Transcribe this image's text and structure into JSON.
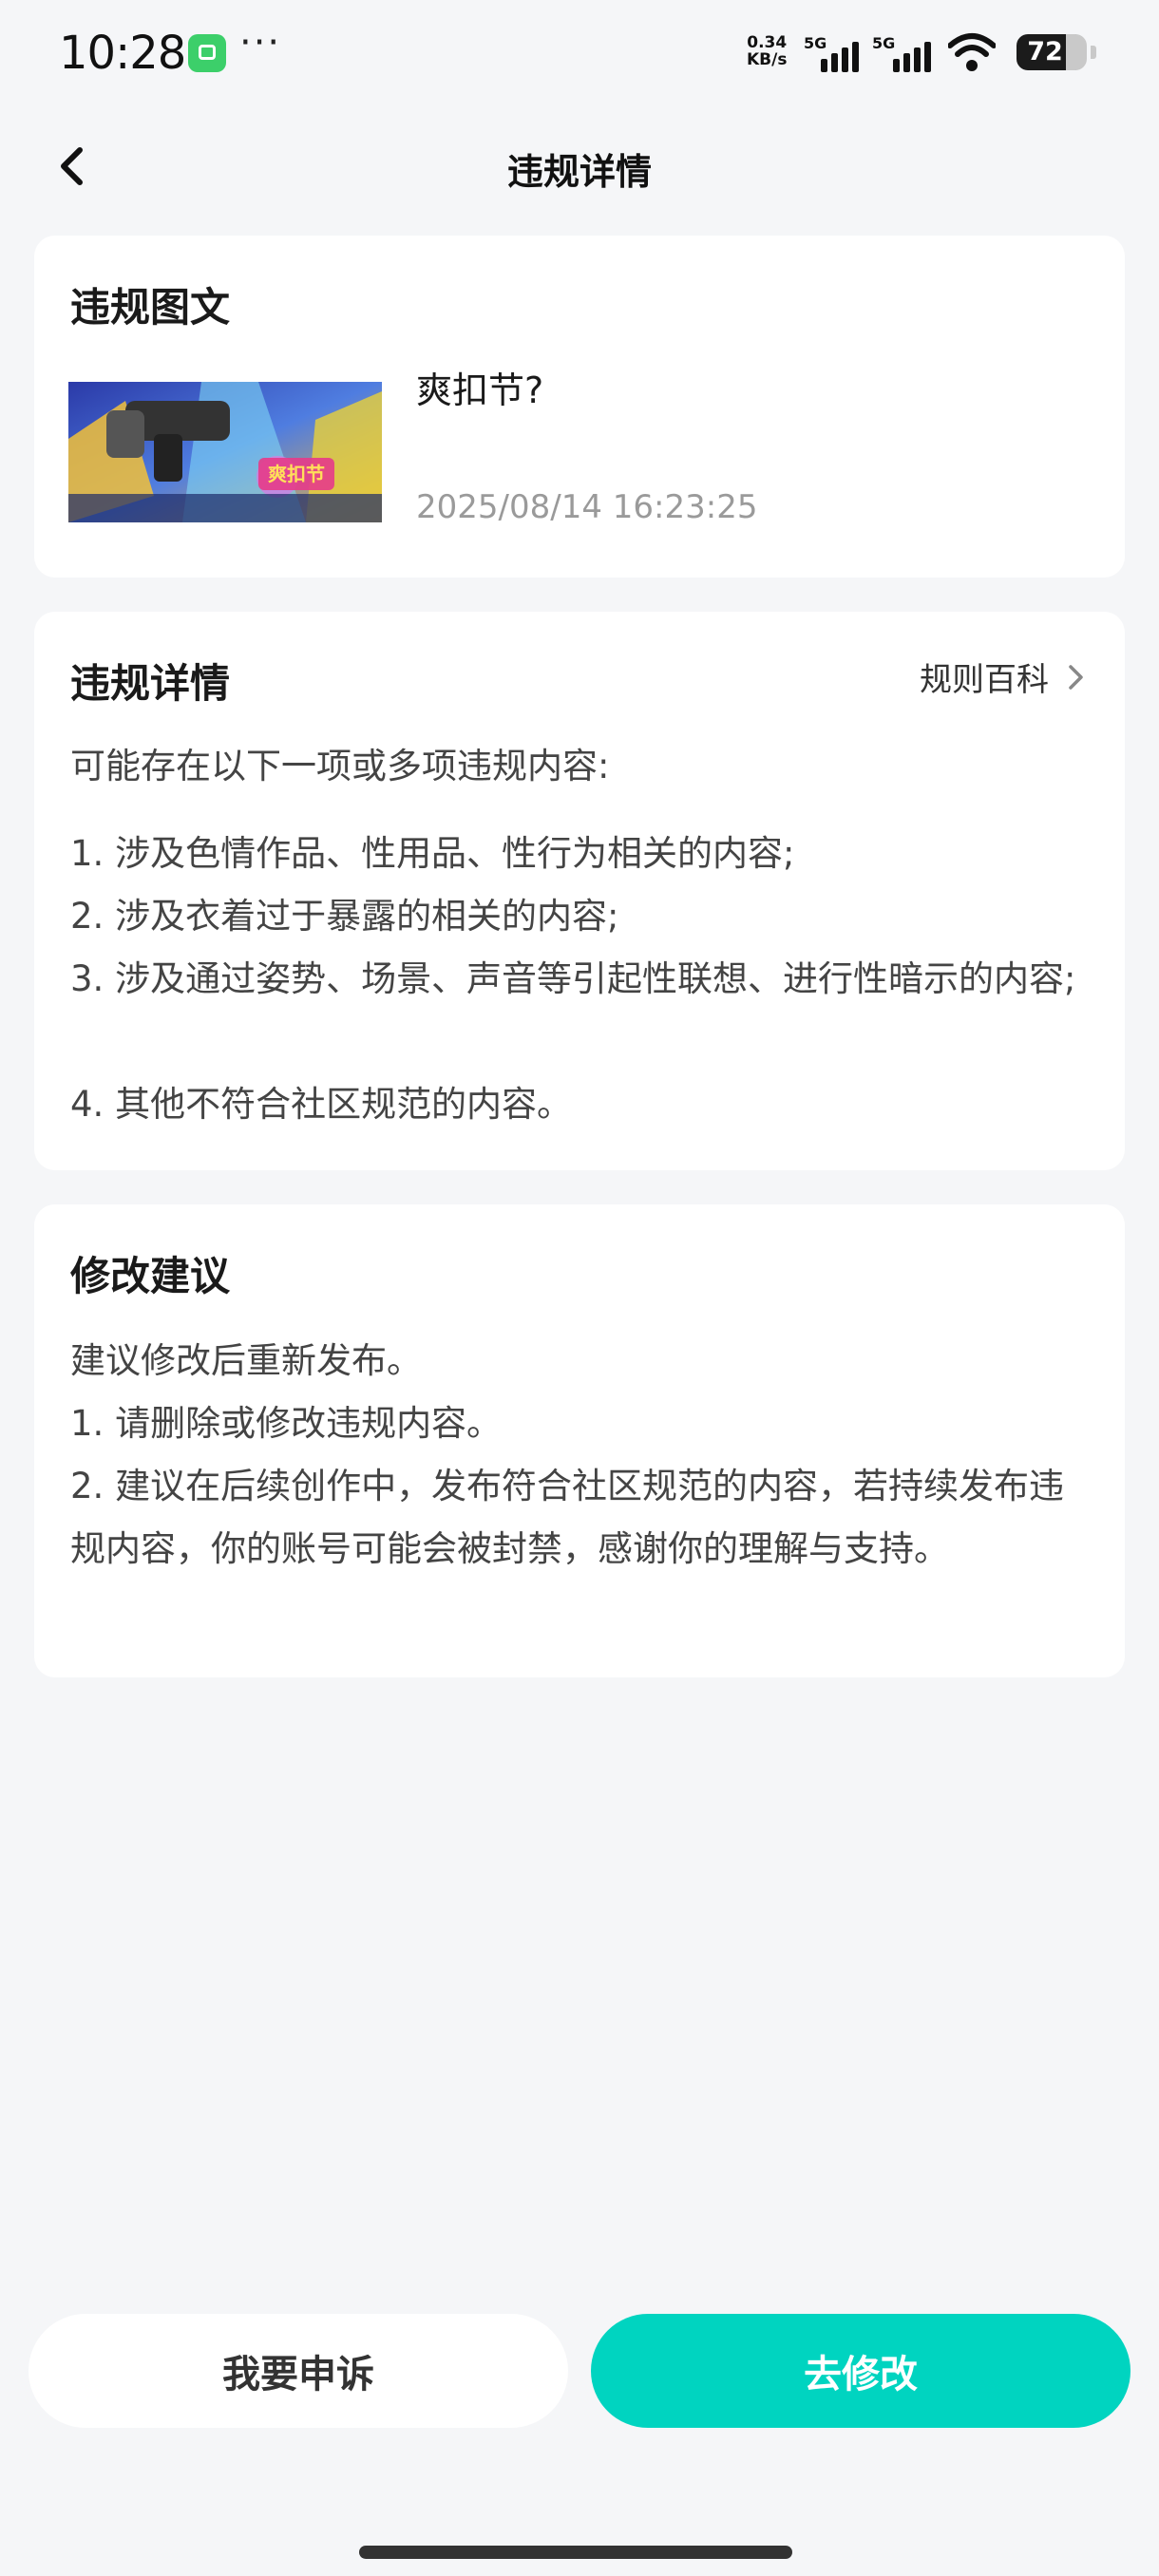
{
  "status": {
    "time": "10:28",
    "speed_top": "0.34",
    "speed_bottom": "KB/s",
    "net1": "5G",
    "net2": "5G",
    "battery": "72"
  },
  "nav": {
    "title": "违规详情"
  },
  "post_card": {
    "title": "违规图文",
    "post_title": "爽扣节?",
    "post_time": "2025/08/14 16:23:25",
    "thumb_text": "爽扣节"
  },
  "detail_card": {
    "title": "违规详情",
    "rules_link": "规则百科",
    "intro": "可能存在以下一项或多项违规内容:",
    "items": [
      "1. 涉及色情作品、性用品、性行为相关的内容;",
      "2. 涉及衣着过于暴露的相关的内容;",
      "3. 涉及通过姿势、场景、声音等引起性联想、进行性暗示的内容;",
      "4. 其他不符合社区规范的内容。"
    ]
  },
  "suggest_card": {
    "title": "修改建议",
    "lines": [
      "建议修改后重新发布。",
      "1. 请删除或修改违规内容。",
      "2. 建议在后续创作中，发布符合社区规范的内容，若持续发布违规内容，你的账号可能会被封禁，感谢你的理解与支持。"
    ]
  },
  "actions": {
    "appeal": "我要申诉",
    "modify": "去修改"
  },
  "colors": {
    "accent": "#00d4c0",
    "background": "#f5f6f8"
  }
}
